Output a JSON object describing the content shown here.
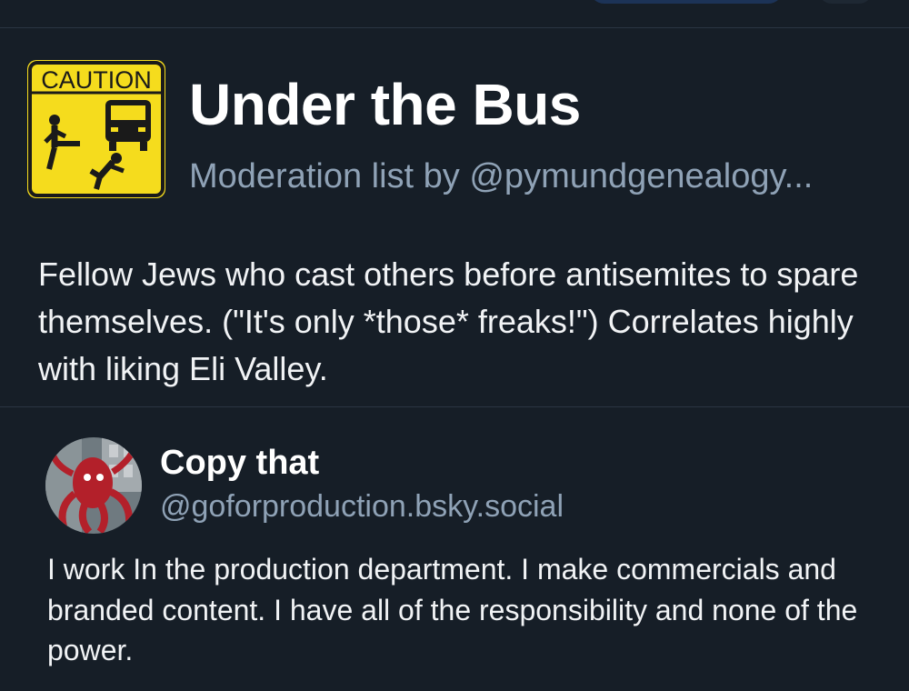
{
  "list": {
    "avatar_text": "CAUTION",
    "title": "Under the Bus",
    "subtitle": "Moderation list by @pymundgenealogy...",
    "description": "Fellow Jews who cast others before antisemites to spare themselves. (\"It's only *those* freaks!\") Correlates highly with liking Eli Valley."
  },
  "profile": {
    "name": "Copy that",
    "handle": "@goforproduction.bsky.social",
    "bio": "I work In the production department.  I make commercials and branded content.  I have all of the responsibility and none of the power."
  },
  "colors": {
    "background": "#161e27",
    "muted_text": "#8fa2b6",
    "divider": "#2a3542",
    "caution_yellow": "#f5dc1d"
  }
}
